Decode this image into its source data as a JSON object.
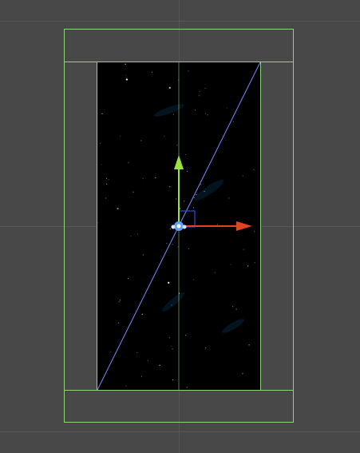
{
  "scene": {
    "background_color": "#484848",
    "grid_color": "#565656",
    "canvas_outline_color": "#8fd37a",
    "camera_background": "#000000"
  },
  "gizmo": {
    "y_axis_color": "#9be23a",
    "x_axis_color": "#e0451f",
    "pivot_color": "#5aa0ff",
    "rect_handle_color": "#2a4fd8",
    "diagonal_color": "#7a8cff",
    "icons": {
      "move_y": "arrow-up-icon",
      "move_x": "arrow-right-icon",
      "pivot": "pivot-circle-icon",
      "rect": "rect-handle-icon"
    }
  }
}
